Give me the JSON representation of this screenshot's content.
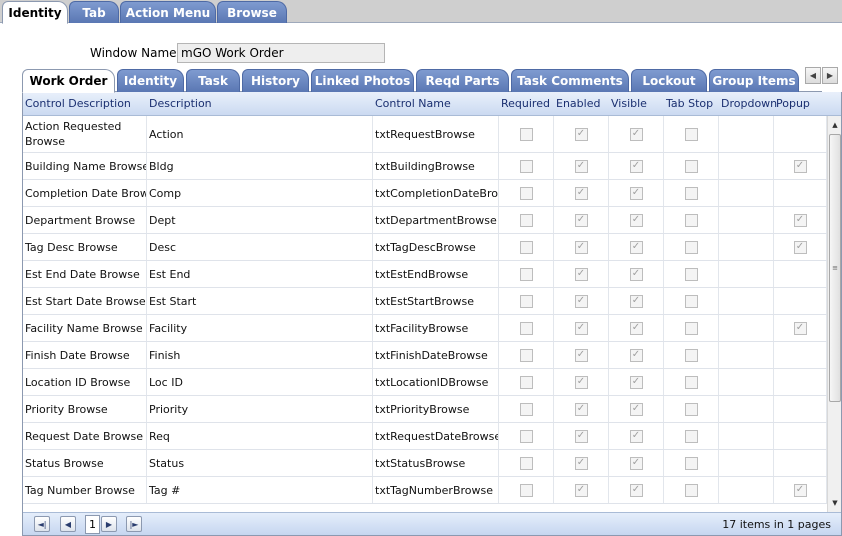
{
  "top_tabs": [
    {
      "label": "Identity",
      "active": true
    },
    {
      "label": "Tab",
      "active": false
    },
    {
      "label": "Action Menu",
      "active": false
    },
    {
      "label": "Browse",
      "active": false
    }
  ],
  "window_name": {
    "label": "Window Name:",
    "value": "mGO Work Order"
  },
  "inner_tabs": [
    {
      "label": "Work Order",
      "active": true
    },
    {
      "label": "Identity",
      "active": false
    },
    {
      "label": "Task",
      "active": false
    },
    {
      "label": "History",
      "active": false
    },
    {
      "label": "Linked Photos",
      "active": false
    },
    {
      "label": "Reqd Parts",
      "active": false
    },
    {
      "label": "Task Comments",
      "active": false
    },
    {
      "label": "Lockout",
      "active": false
    },
    {
      "label": "Group Items",
      "active": false
    }
  ],
  "tab_scroll": {
    "left_icon": "triangle-left-icon",
    "right_icon": "triangle-right-icon"
  },
  "grid": {
    "columns": [
      "Control Description",
      "Description",
      "Control Name",
      "Required",
      "Enabled",
      "Visible",
      "Tab Stop",
      "Dropdown",
      "Popup"
    ],
    "rows": [
      {
        "control_description": "Action Requested Browse",
        "description": "Action",
        "control_name": "txtRequestBrowse",
        "required": false,
        "enabled": true,
        "visible": true,
        "tab_stop": false,
        "popup": null
      },
      {
        "control_description": "Building Name Browse",
        "description": "Bldg",
        "control_name": "txtBuildingBrowse",
        "required": false,
        "enabled": true,
        "visible": true,
        "tab_stop": false,
        "popup": true
      },
      {
        "control_description": "Completion Date Browse",
        "description": "Comp",
        "control_name": "txtCompletionDateBrowse",
        "required": false,
        "enabled": true,
        "visible": true,
        "tab_stop": false,
        "popup": null
      },
      {
        "control_description": "Department Browse",
        "description": "Dept",
        "control_name": "txtDepartmentBrowse",
        "required": false,
        "enabled": true,
        "visible": true,
        "tab_stop": false,
        "popup": true
      },
      {
        "control_description": "Tag Desc Browse",
        "description": "Desc",
        "control_name": "txtTagDescBrowse",
        "required": false,
        "enabled": true,
        "visible": true,
        "tab_stop": false,
        "popup": true
      },
      {
        "control_description": "Est End Date Browse",
        "description": "Est End",
        "control_name": "txtEstEndBrowse",
        "required": false,
        "enabled": true,
        "visible": true,
        "tab_stop": false,
        "popup": null
      },
      {
        "control_description": "Est Start Date Browse",
        "description": "Est Start",
        "control_name": "txtEstStartBrowse",
        "required": false,
        "enabled": true,
        "visible": true,
        "tab_stop": false,
        "popup": null
      },
      {
        "control_description": "Facility Name Browse",
        "description": "Facility",
        "control_name": "txtFacilityBrowse",
        "required": false,
        "enabled": true,
        "visible": true,
        "tab_stop": false,
        "popup": true
      },
      {
        "control_description": "Finish Date Browse",
        "description": "Finish",
        "control_name": "txtFinishDateBrowse",
        "required": false,
        "enabled": true,
        "visible": true,
        "tab_stop": false,
        "popup": null
      },
      {
        "control_description": "Location ID Browse",
        "description": "Loc ID",
        "control_name": "txtLocationIDBrowse",
        "required": false,
        "enabled": true,
        "visible": true,
        "tab_stop": false,
        "popup": null
      },
      {
        "control_description": "Priority Browse",
        "description": "Priority",
        "control_name": "txtPriorityBrowse",
        "required": false,
        "enabled": true,
        "visible": true,
        "tab_stop": false,
        "popup": null
      },
      {
        "control_description": "Request Date Browse",
        "description": "Req",
        "control_name": "txtRequestDateBrowse",
        "required": false,
        "enabled": true,
        "visible": true,
        "tab_stop": false,
        "popup": null
      },
      {
        "control_description": "Status Browse",
        "description": "Status",
        "control_name": "txtStatusBrowse",
        "required": false,
        "enabled": true,
        "visible": true,
        "tab_stop": false,
        "popup": null
      },
      {
        "control_description": "Tag Number Browse",
        "description": "Tag #",
        "control_name": "txtTagNumberBrowse",
        "required": false,
        "enabled": true,
        "visible": true,
        "tab_stop": false,
        "popup": true
      }
    ]
  },
  "pager": {
    "first_icon": "first-page-icon",
    "prev_icon": "prev-page-icon",
    "current_page": "1",
    "next_icon": "next-page-icon",
    "last_icon": "last-page-icon",
    "info": "17 items in 1 pages"
  },
  "scrollbar": {
    "up_icon": "scroll-up-icon",
    "down_icon": "scroll-down-icon"
  },
  "colors": {
    "tab_blue": "#6a86c0",
    "header_text": "#1a2f70",
    "pager_bg": "#c6d6f0"
  }
}
